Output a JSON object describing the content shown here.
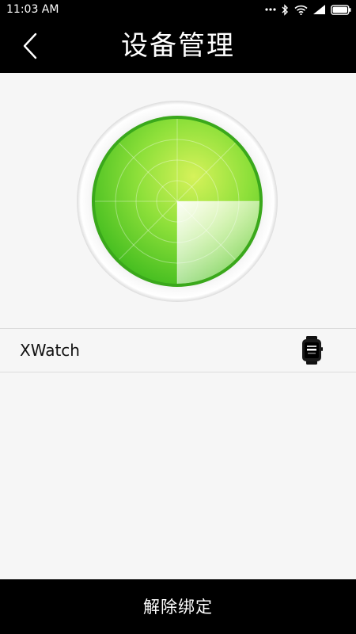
{
  "status_bar": {
    "time": "11:03 AM",
    "icons": [
      "more-dots-icon",
      "bluetooth-icon",
      "wifi-icon",
      "signal-icon",
      "battery-icon"
    ]
  },
  "nav": {
    "title": "设备管理",
    "back_icon": "chevron-left-icon"
  },
  "radar": {
    "icon": "radar-scan-icon",
    "accent": "#5fd22a",
    "accent_light": "#c6ef4a"
  },
  "device": {
    "name": "XWatch",
    "icon": "smartwatch-icon"
  },
  "footer": {
    "unbind_label": "解除绑定"
  }
}
